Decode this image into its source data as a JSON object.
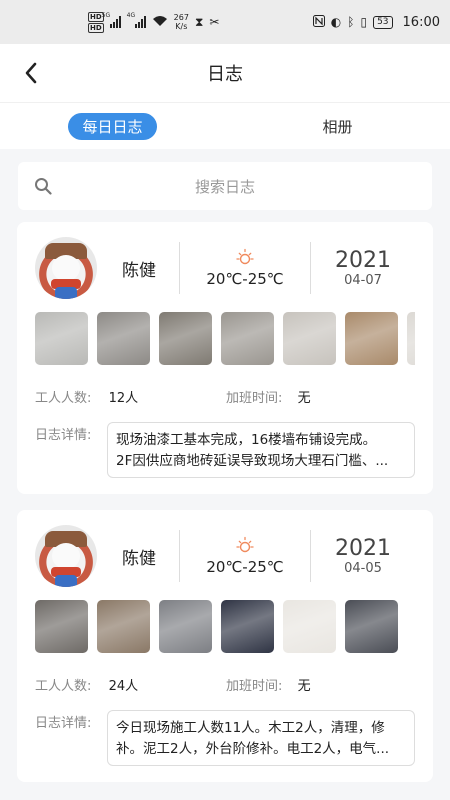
{
  "status_bar": {
    "hd1": "HD",
    "hd2": "HD",
    "net1": "5G",
    "net2": "4G",
    "speed_value": "267",
    "speed_unit": "K/s",
    "battery": "53",
    "time": "16:00"
  },
  "nav": {
    "title": "日志"
  },
  "tabs": [
    {
      "label": "每日日志",
      "active": true
    },
    {
      "label": "相册",
      "active": false
    }
  ],
  "search": {
    "placeholder": "搜索日志"
  },
  "labels": {
    "workers": "工人人数:",
    "overtime": "加班时间:",
    "detail": "日志详情:"
  },
  "logs": [
    {
      "name": "陈健",
      "temp": "20℃-25℃",
      "year": "2021",
      "date": "04-07",
      "workers": "12人",
      "overtime": "无",
      "detail_line1": "现场油漆工基本完成，16楼墙布铺设完成。",
      "detail_line2": "2F因供应商地砖延误导致现场大理石门槛、...",
      "photo_colors": [
        "#b9b9b6",
        "#8d8a86",
        "#7f7a72",
        "#9a9690",
        "#c7c3bd",
        "#a98a6a",
        "#dcd9d4"
      ]
    },
    {
      "name": "陈健",
      "temp": "20℃-25℃",
      "year": "2021",
      "date": "04-05",
      "workers": "24人",
      "overtime": "无",
      "detail_line1": "今日现场施工人数11人。木工2人，清理，修",
      "detail_line2": "补。泥工2人，外台阶修补。电工2人，电气...",
      "photo_colors": [
        "#6e6a66",
        "#8a7866",
        "#7d7f84",
        "#2f3444",
        "#e9e6e1",
        "#4a4d55"
      ]
    }
  ]
}
